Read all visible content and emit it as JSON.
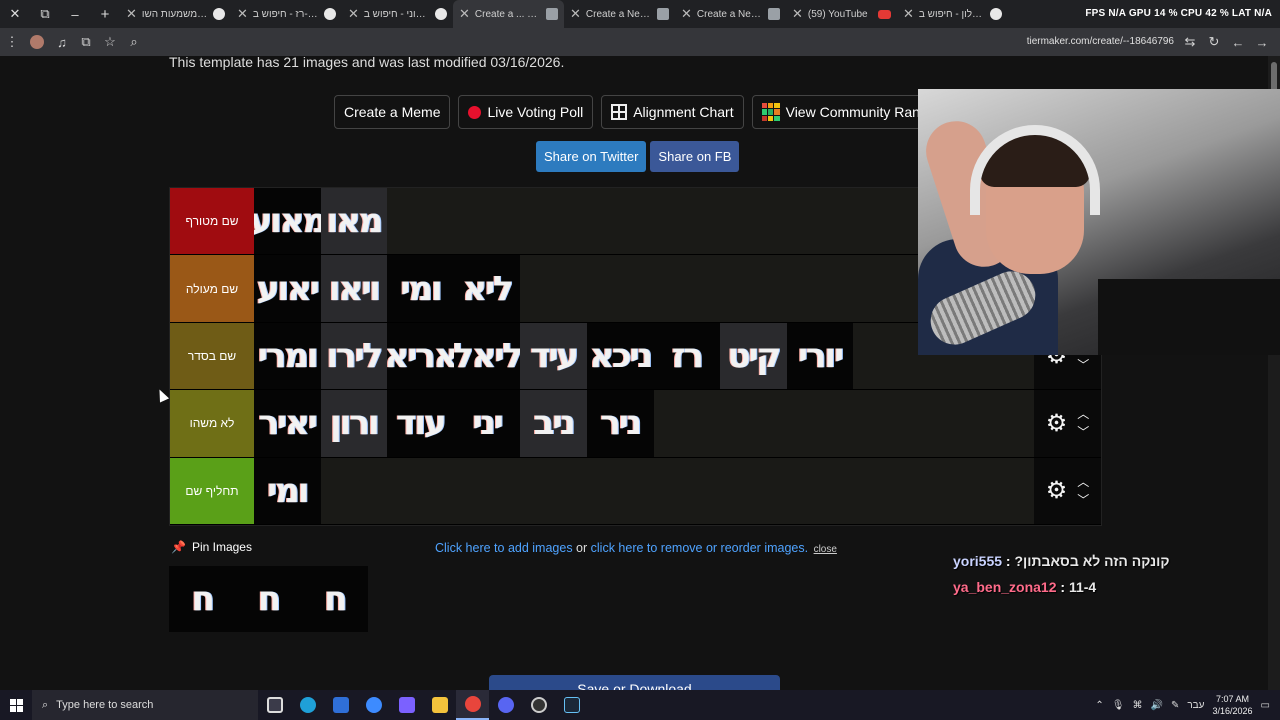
{
  "browser": {
    "tabs": [
      {
        "label": "",
        "icon": "restore-icon"
      },
      {
        "label": "מהי משמעות השו",
        "icon": "google-favicon"
      },
      {
        "label": "רז - חיפוש ב-Google",
        "icon": "google-favicon"
      },
      {
        "label": "רוני - חיפוש ב-Google",
        "icon": "google-favicon"
      },
      {
        "label": "Create a ... שמות",
        "icon": "tiermaker-favicon",
        "active": true
      },
      {
        "label": "Create a New Tier",
        "icon": "tiermaker-favicon"
      },
      {
        "label": "Create a New Tier",
        "icon": "tiermaker-favicon"
      },
      {
        "label": "(59) YouTube",
        "icon": "youtube-favicon"
      },
      {
        "label": "עגלון - חיפוש ב-Google",
        "icon": "google-favicon"
      }
    ],
    "perf_overlay": "FPS N/A   GPU 14 %   CPU 42 %   LAT N/A",
    "url": "tiermaker.com/create/--18646796"
  },
  "page": {
    "template_info": "This template has 21 images and was last modified 03/16/2026.",
    "buttons": {
      "meme": "Create a Meme",
      "poll": "Live Voting Poll",
      "alignment": "Alignment Chart",
      "community": "View Community Rankings"
    },
    "share": {
      "twitter": "Share on Twitter",
      "fb": "Share on FB"
    },
    "tiers": [
      {
        "label": "שם מטורף",
        "color": "#a00c10",
        "items": [
          "מאוע",
          "מאו"
        ]
      },
      {
        "label": "שם מעולה",
        "color": "#9a5817",
        "items": [
          "יאוע",
          "ויאו",
          "ומי",
          "ליא"
        ]
      },
      {
        "label": "שם בסדר",
        "color": "#6f5c16",
        "items": [
          "ומרי",
          "לירו",
          "אריא",
          "ליאל",
          "עיד",
          "ניכא",
          "רז",
          "קיט",
          "יורי"
        ]
      },
      {
        "label": "לא משהו",
        "color": "#6f6f16",
        "items": [
          "יאיר",
          "ורון",
          "עוד",
          "יני",
          "ניב",
          "ניר"
        ]
      },
      {
        "label": "תחליף שם",
        "color": "#5aa018",
        "items": [
          "ומי"
        ]
      }
    ],
    "pin_label": "Pin Images",
    "links": {
      "add": "Click here to add images",
      "or": " or ",
      "remove": "click here to remove or reorder images.",
      "close": "close"
    },
    "pinned_items": [
      "ח",
      "ח",
      "ח"
    ],
    "save_label": "Save or Download"
  },
  "chat": [
    {
      "user": "yori555",
      "user_color": "#c9d3ff",
      "message": "קונקה הזה לא בסאבתון?"
    },
    {
      "user": "ya_ben_zona12",
      "user_color": "#ff6b8a",
      "message": "11-4"
    }
  ],
  "taskbar": {
    "search_placeholder": "Type here to search",
    "lang": "עבר",
    "time": "7:07 AM",
    "date": "3/16/2026"
  }
}
